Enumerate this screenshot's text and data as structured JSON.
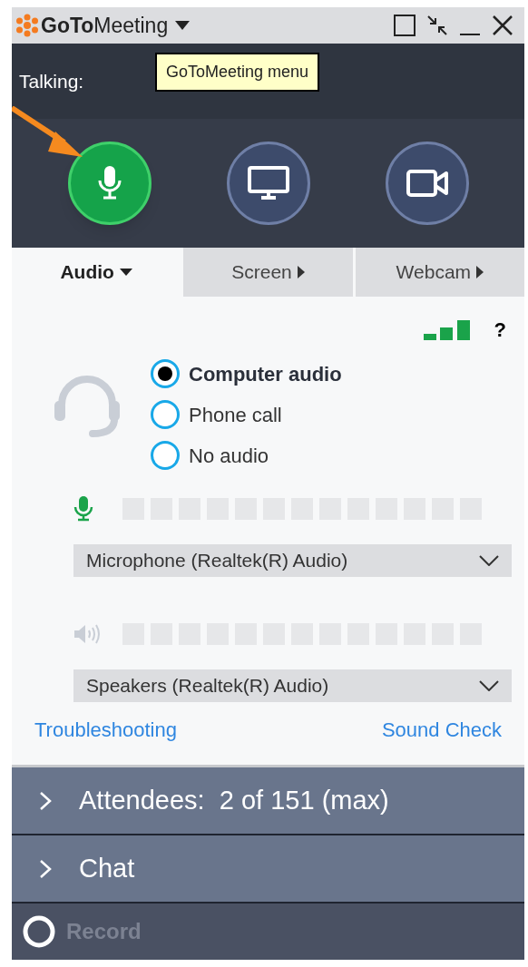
{
  "window": {
    "title_bold": "GoTo",
    "title_rest": "Meeting"
  },
  "tooltip": "GoToMeeting menu",
  "talking_label": "Talking:",
  "controls": [
    {
      "kind": "mic",
      "active": true
    },
    {
      "kind": "screen",
      "active": false
    },
    {
      "kind": "webcam",
      "active": false
    }
  ],
  "tabs": [
    {
      "label": "Audio",
      "selected": true
    },
    {
      "label": "Screen",
      "selected": false
    },
    {
      "label": "Webcam",
      "selected": false
    }
  ],
  "help": "?",
  "audio_options": [
    {
      "label": "Computer audio",
      "selected": true
    },
    {
      "label": "Phone call",
      "selected": false
    },
    {
      "label": "No audio",
      "selected": false
    }
  ],
  "devices": [
    {
      "kind": "mic",
      "value": "Microphone (Realtek(R) Audio)"
    },
    {
      "kind": "speaker",
      "value": "Speakers (Realtek(R) Audio)"
    }
  ],
  "links": [
    "Troubleshooting",
    "Sound Check"
  ],
  "panels": [
    {
      "label": "Attendees:  2 of 151 (max)",
      "expanded": false
    },
    {
      "label": "Chat",
      "expanded": false
    }
  ],
  "record": {
    "label": "Record",
    "disabled": true
  }
}
